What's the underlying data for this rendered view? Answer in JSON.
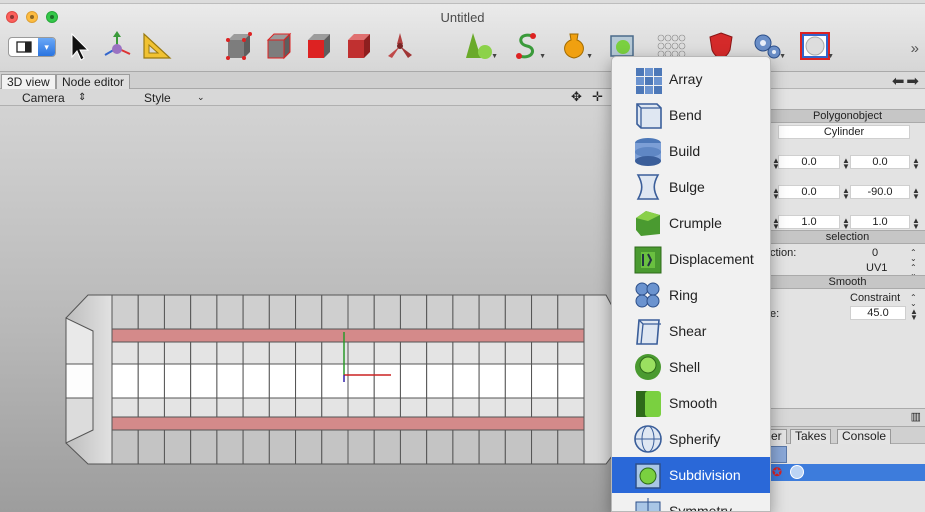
{
  "window": {
    "title": "Untitled"
  },
  "toolbar": {
    "overflow_label": "»",
    "tools": [
      "view-select",
      "move-tool",
      "transform-tool",
      "measure-tool",
      "cube-vertices",
      "cube-edges",
      "cube-faces",
      "cube-objects",
      "axis-tool",
      "primitives-cone",
      "spline-tool",
      "nurbs-tool",
      "deformer-tool",
      "particles-tool",
      "shield-tool",
      "gears-tool",
      "render-sphere"
    ]
  },
  "tabs": {
    "view3d": "3D view",
    "node_editor": "Node editor"
  },
  "viewport_toolbar": {
    "camera": "Camera",
    "style": "Style"
  },
  "properties": {
    "header": "Polygonobject",
    "name_value": "Cylinder",
    "row1": [
      "0.0",
      "0.0"
    ],
    "row2": [
      "0.0",
      "-90.0"
    ],
    "row3": [
      "1.0",
      "1.0"
    ],
    "selection_header": "selection",
    "selection_label": "ction:",
    "selection_value": "0",
    "uv_value": "UV1",
    "smooth_header": "Smooth",
    "constraint_label": "Constraint",
    "angle_label": "e:",
    "angle_value": "45.0"
  },
  "bottom_tabs": {
    "objects_partial": "er",
    "takes": "Takes",
    "console": "Console"
  },
  "menu": {
    "items": [
      {
        "label": "Array",
        "icon": "array-icon"
      },
      {
        "label": "Bend",
        "icon": "bend-icon"
      },
      {
        "label": "Build",
        "icon": "build-icon"
      },
      {
        "label": "Bulge",
        "icon": "bulge-icon"
      },
      {
        "label": "Crumple",
        "icon": "crumple-icon"
      },
      {
        "label": "Displacement",
        "icon": "displacement-icon"
      },
      {
        "label": "Ring",
        "icon": "ring-icon"
      },
      {
        "label": "Shear",
        "icon": "shear-icon"
      },
      {
        "label": "Shell",
        "icon": "shell-icon"
      },
      {
        "label": "Smooth",
        "icon": "smooth-icon"
      },
      {
        "label": "Spherify",
        "icon": "spherify-icon"
      },
      {
        "label": "Subdivision",
        "icon": "subdivision-icon",
        "selected": true
      },
      {
        "label": "Symmetry",
        "icon": "symmetry-icon"
      }
    ]
  },
  "colors": {
    "accent": "#2a68d8",
    "highlight_band": "#d88a8a"
  }
}
